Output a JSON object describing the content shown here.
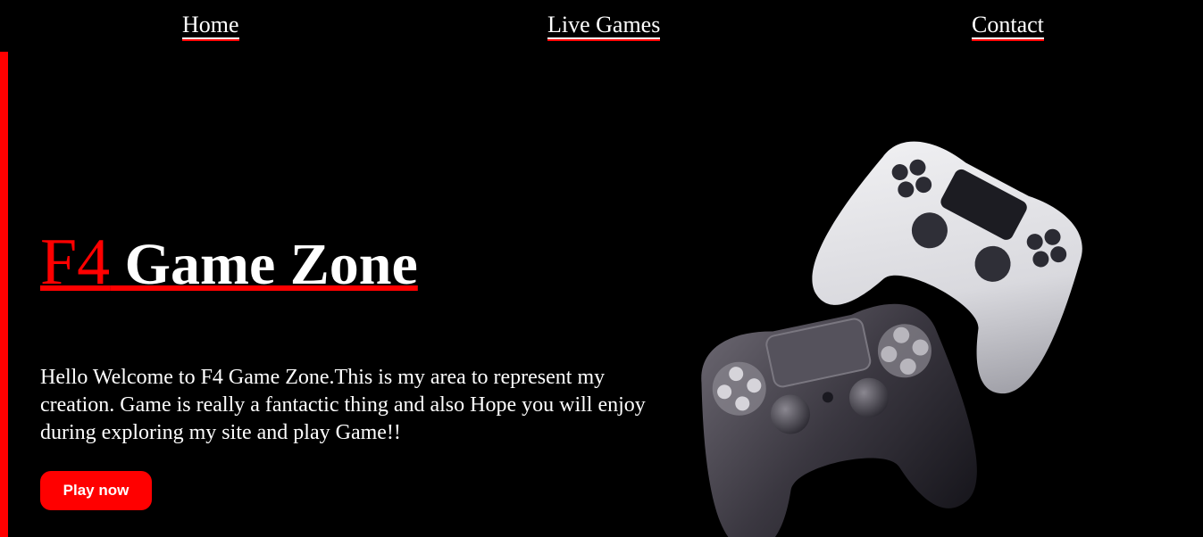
{
  "nav": {
    "home": "Home",
    "live_games": "Live Games",
    "contact": "Contact"
  },
  "hero": {
    "title_prefix": "F4",
    "title_rest": " Game Zone",
    "description": "Hello Welcome to F4 Game Zone.This is my area to represent my creation. Game is really a fantactic thing and also Hope you will enjoy during exploring my site and play Game!!",
    "cta_label": "Play now"
  },
  "image": {
    "subject": "two game controllers (white and black) on black background"
  },
  "colors": {
    "accent": "#ff0000",
    "background": "#000000",
    "text": "#ffffff"
  }
}
